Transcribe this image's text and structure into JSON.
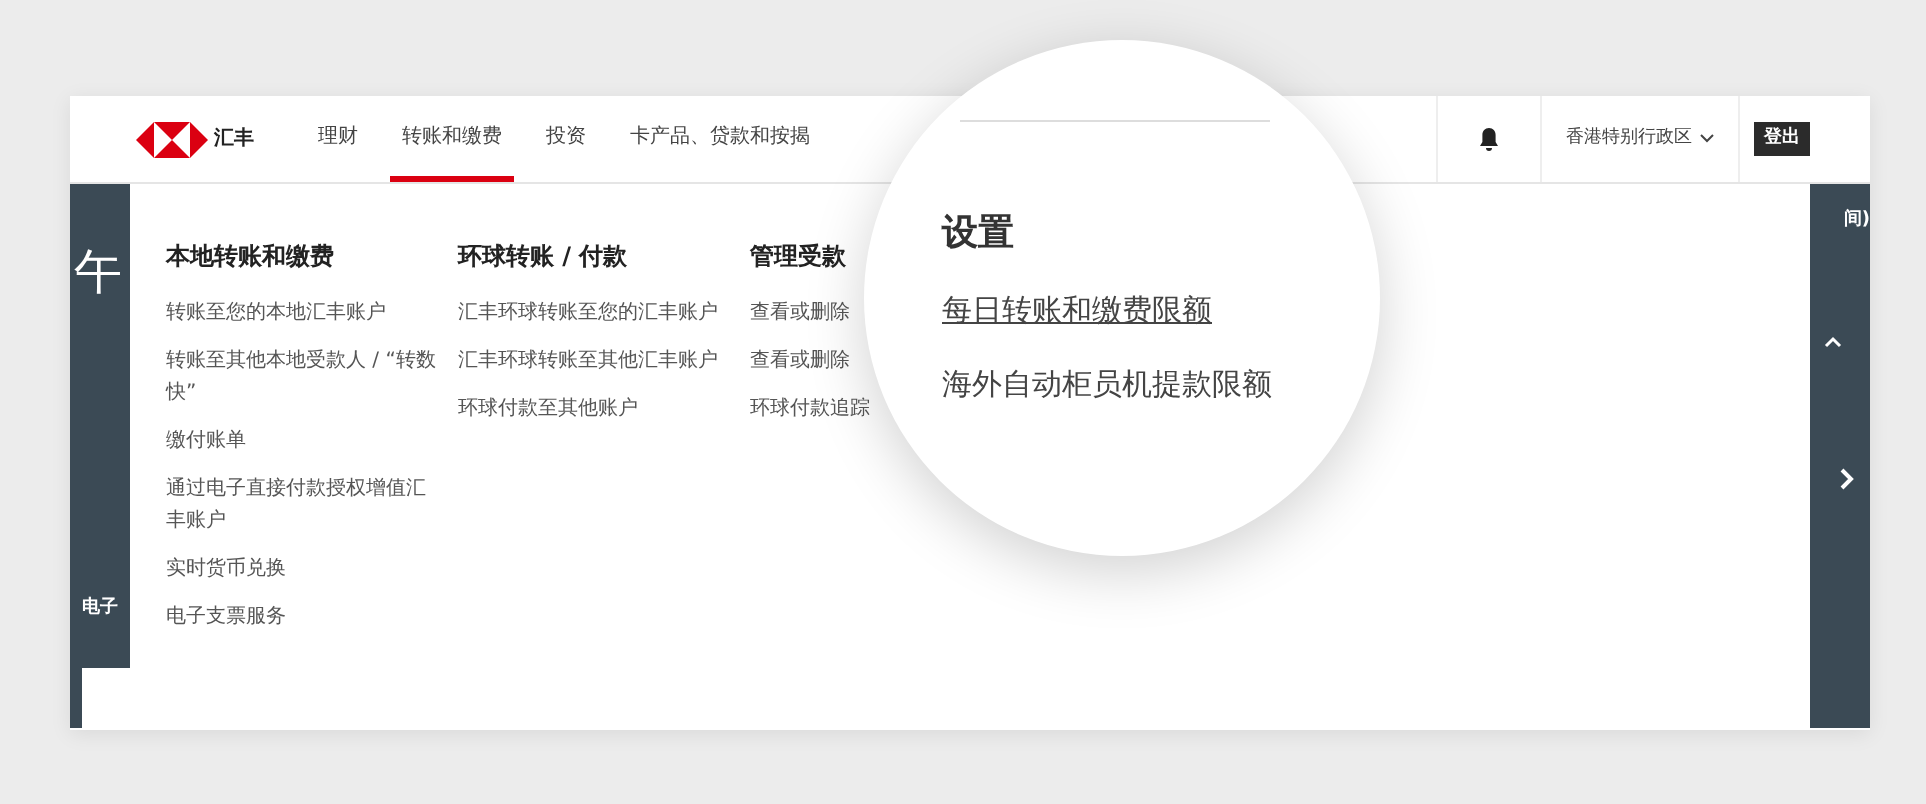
{
  "header": {
    "logo_text": "汇丰",
    "nav": [
      {
        "label": "理财",
        "selected": false
      },
      {
        "label": "转账和缴费",
        "selected": true
      },
      {
        "label": "投资",
        "selected": false
      },
      {
        "label": "卡产品、贷款和按揭",
        "selected": false
      }
    ],
    "region": "香港特别行政区",
    "logout": "登出"
  },
  "hero": {
    "heading_fragment": "午",
    "side_fragment": "电子",
    "corner_fragment": "间)"
  },
  "menu": {
    "columns": [
      {
        "title": "本地转账和缴费",
        "links": [
          "转账至您的本地汇丰账户",
          "转账至其他本地受款人 / “转数快”",
          "缴付账单",
          "通过电子直接付款授权增值汇丰账户",
          "实时货币兑换",
          "电子支票服务"
        ]
      },
      {
        "title": "环球转账 / 付款",
        "links": [
          "汇丰环球转账至您的汇丰账户",
          "汇丰环球转账至其他汇丰账户",
          "环球付款至其他账户"
        ]
      },
      {
        "title": "管理受款",
        "links": [
          "查看或删除",
          "查看或删除",
          "环球付款追踪"
        ]
      }
    ]
  },
  "magnifier": {
    "title": "设置",
    "links": [
      {
        "label": "每日转账和缴费限额",
        "hovered": true
      },
      {
        "label": "海外自动柜员机提款限额",
        "hovered": false
      }
    ]
  }
}
